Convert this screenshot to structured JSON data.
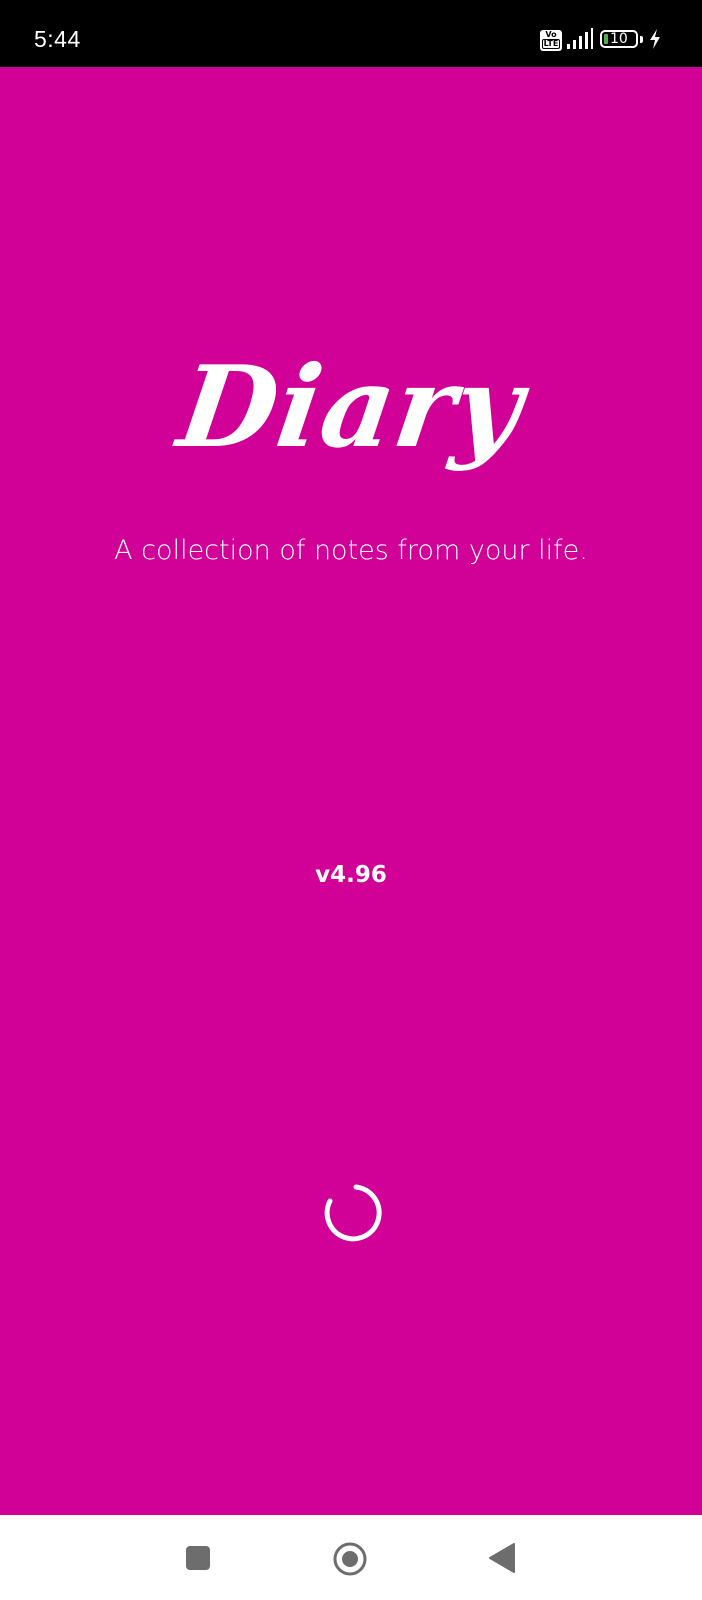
{
  "status_bar": {
    "time": "5:44",
    "network_badge": [
      "Vo",
      "LTE"
    ],
    "battery_level": "10",
    "icons": [
      "volte-icon",
      "signal-icon",
      "battery-icon",
      "charging-icon"
    ]
  },
  "splash": {
    "app_name": "Diary",
    "tagline": "A collection of notes from your life.",
    "version": "v4.96",
    "loading_icon": "spinner-icon"
  },
  "nav_bar": {
    "icons": [
      "recents-icon",
      "home-icon",
      "back-icon"
    ]
  },
  "colors": {
    "background": "#d10097",
    "text": "#ffffff",
    "nav_bar": "#ffffff",
    "nav_icon": "#6d6d6d"
  }
}
